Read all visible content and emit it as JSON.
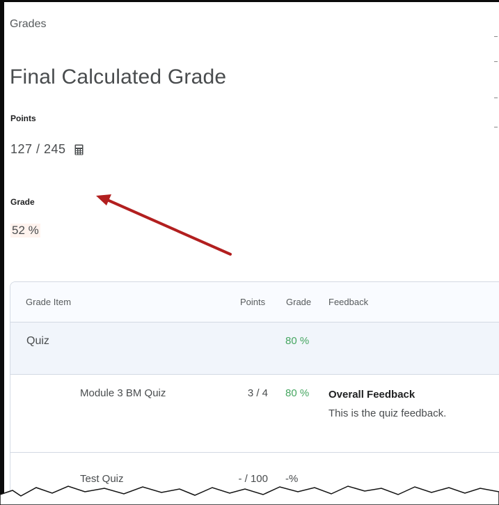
{
  "breadcrumb": "Grades",
  "title": "Final Calculated Grade",
  "points": {
    "label": "Points",
    "value": "127 / 245",
    "icon": "calculator-icon"
  },
  "grade": {
    "label": "Grade",
    "value": "52 %"
  },
  "table": {
    "headers": {
      "item": "Grade Item",
      "points": "Points",
      "grade": "Grade",
      "feedback": "Feedback"
    },
    "category": {
      "name": "Quiz",
      "points": "",
      "grade": "80 %"
    },
    "rows": [
      {
        "name": "Module 3 BM Quiz",
        "points": "3 / 4",
        "grade": "80 %",
        "feedback_title": "Overall Feedback",
        "feedback_text": "This is the quiz feedback."
      },
      {
        "name": "Test Quiz",
        "points": "- / 100",
        "grade": "-%",
        "feedback_title": "",
        "feedback_text": ""
      }
    ]
  },
  "colors": {
    "grade_green": "#46a661",
    "arrow": "#b21f1f",
    "category_bg": "#f1f5fb"
  }
}
